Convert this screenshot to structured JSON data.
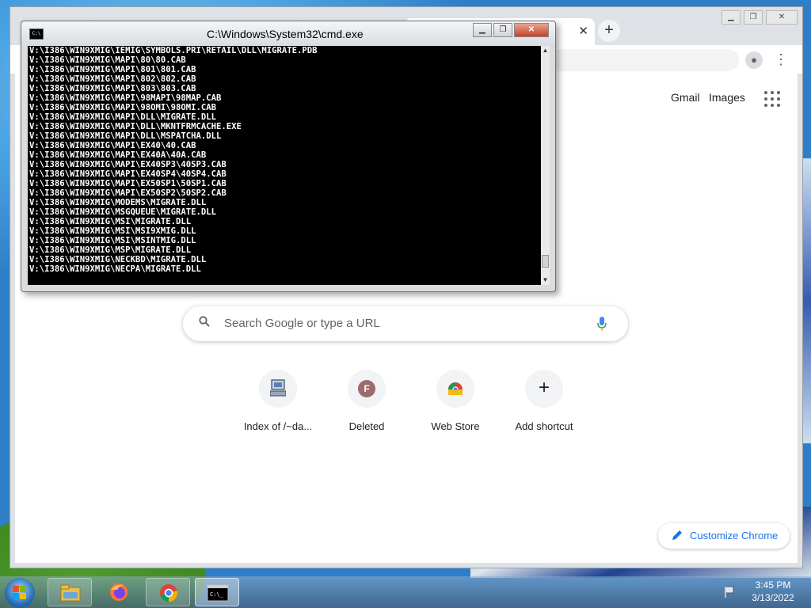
{
  "cmd": {
    "title": "C:\\Windows\\System32\\cmd.exe",
    "icon_label": "C:\\",
    "lines": [
      "V:\\I386\\WIN9XMIG\\IEMIG\\SYMBOLS.PRI\\RETAIL\\DLL\\MIGRATE.PDB",
      "V:\\I386\\WIN9XMIG\\MAPI\\80\\80.CAB",
      "V:\\I386\\WIN9XMIG\\MAPI\\801\\801.CAB",
      "V:\\I386\\WIN9XMIG\\MAPI\\802\\802.CAB",
      "V:\\I386\\WIN9XMIG\\MAPI\\803\\803.CAB",
      "V:\\I386\\WIN9XMIG\\MAPI\\98MAPI\\98MAP.CAB",
      "V:\\I386\\WIN9XMIG\\MAPI\\98OMI\\98OMI.CAB",
      "V:\\I386\\WIN9XMIG\\MAPI\\DLL\\MIGRATE.DLL",
      "V:\\I386\\WIN9XMIG\\MAPI\\DLL\\MKNTFRMCACHE.EXE",
      "V:\\I386\\WIN9XMIG\\MAPI\\DLL\\MSPATCHA.DLL",
      "V:\\I386\\WIN9XMIG\\MAPI\\EX40\\40.CAB",
      "V:\\I386\\WIN9XMIG\\MAPI\\EX40A\\40A.CAB",
      "V:\\I386\\WIN9XMIG\\MAPI\\EX40SP3\\40SP3.CAB",
      "V:\\I386\\WIN9XMIG\\MAPI\\EX40SP4\\40SP4.CAB",
      "V:\\I386\\WIN9XMIG\\MAPI\\EX50SP1\\50SP1.CAB",
      "V:\\I386\\WIN9XMIG\\MAPI\\EX50SP2\\50SP2.CAB",
      "V:\\I386\\WIN9XMIG\\MODEMS\\MIGRATE.DLL",
      "V:\\I386\\WIN9XMIG\\MSGQUEUE\\MIGRATE.DLL",
      "V:\\I386\\WIN9XMIG\\MSI\\MIGRATE.DLL",
      "V:\\I386\\WIN9XMIG\\MSI\\MSI9XMIG.DLL",
      "V:\\I386\\WIN9XMIG\\MSI\\MSINTMIG.DLL",
      "V:\\I386\\WIN9XMIG\\MSP\\MIGRATE.DLL",
      "V:\\I386\\WIN9XMIG\\NECKBD\\MIGRATE.DLL",
      "V:\\I386\\WIN9XMIG\\NECPA\\MIGRATE.DLL"
    ]
  },
  "chrome": {
    "header_links": {
      "gmail": "Gmail",
      "images": "Images"
    },
    "search": {
      "placeholder": "Search Google or type a URL"
    },
    "shortcuts": [
      {
        "label": "Index of /~da...",
        "icon": "computer-favicon"
      },
      {
        "label": "Deleted",
        "icon": "letter-favicon",
        "letter": "F"
      },
      {
        "label": "Web Store",
        "icon": "chrome-webstore-favicon"
      },
      {
        "label": "Add shortcut",
        "icon": "plus-icon",
        "glyph": "+"
      }
    ],
    "customize_label": "Customize Chrome",
    "colors": {
      "accent": "#1a73e8"
    }
  },
  "taskbar": {
    "time": "3:45 PM",
    "date": "3/13/2022",
    "items": [
      "file-explorer",
      "firefox",
      "chrome",
      "cmd"
    ]
  }
}
